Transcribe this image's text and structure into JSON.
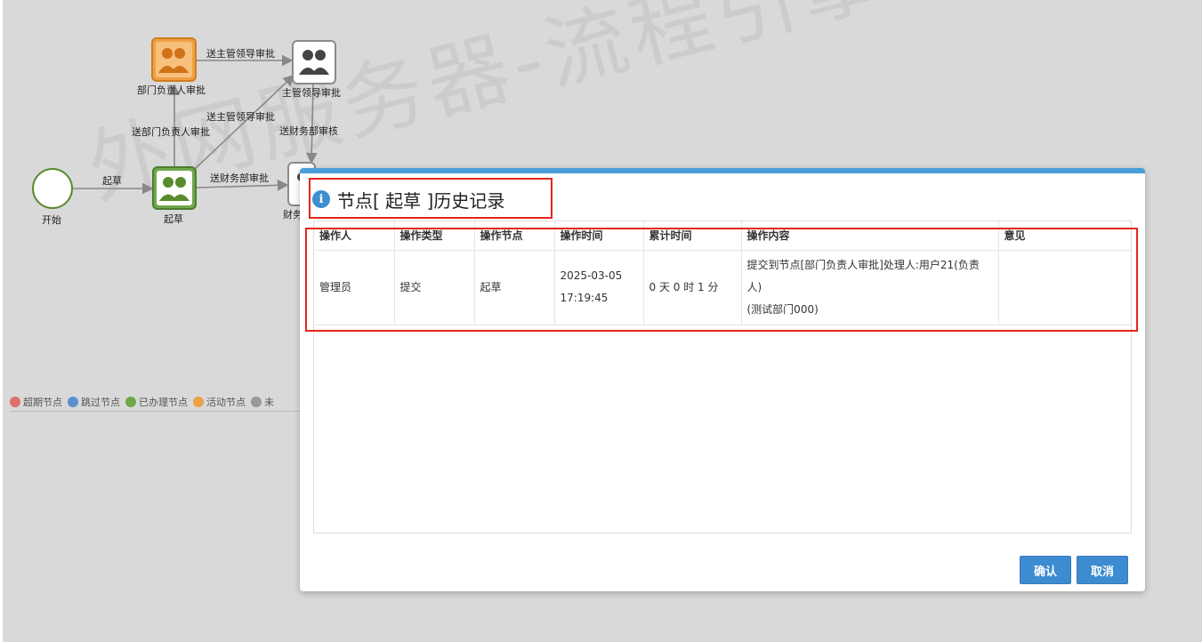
{
  "watermark": "外网服务器-流程引擎",
  "flow": {
    "nodes": {
      "start": "开始",
      "draft": "起草",
      "dept_head": "部门负责人审批",
      "supervisor": "主管领导审批",
      "finance": "财务"
    },
    "edges": {
      "start_draft": "起草",
      "draft_dept": "送部门负责人审批",
      "draft_supervisor": "送主管领导审批",
      "dept_supervisor": "送主管领导审批",
      "supervisor_finance": "送财务部审核",
      "draft_finance": "送财务部审批"
    }
  },
  "legend": [
    {
      "label": "超期节点",
      "color": "#e06c6c"
    },
    {
      "label": "跳过节点",
      "color": "#5b8fd1"
    },
    {
      "label": "已办理节点",
      "color": "#6fa84a"
    },
    {
      "label": "活动节点",
      "color": "#eea046"
    },
    {
      "label": "未",
      "color": "#999999"
    }
  ],
  "modal": {
    "title": "节点[ 起草 ]历史记录",
    "columns": [
      "操作人",
      "操作类型",
      "操作节点",
      "操作时间",
      "累计时间",
      "操作内容",
      "意见"
    ],
    "rows": [
      {
        "operator": "管理员",
        "type": "提交",
        "node": "起草",
        "time_date": "2025-03-05",
        "time_clock": "17:19:45",
        "elapsed": "0 天 0 时 1 分",
        "content_line1": "提交到节点[部门负责人审批]处理人:用户21(负责人)",
        "content_line2": "(测试部门000)",
        "opinion": ""
      }
    ],
    "confirm": "确认",
    "cancel": "取消"
  }
}
